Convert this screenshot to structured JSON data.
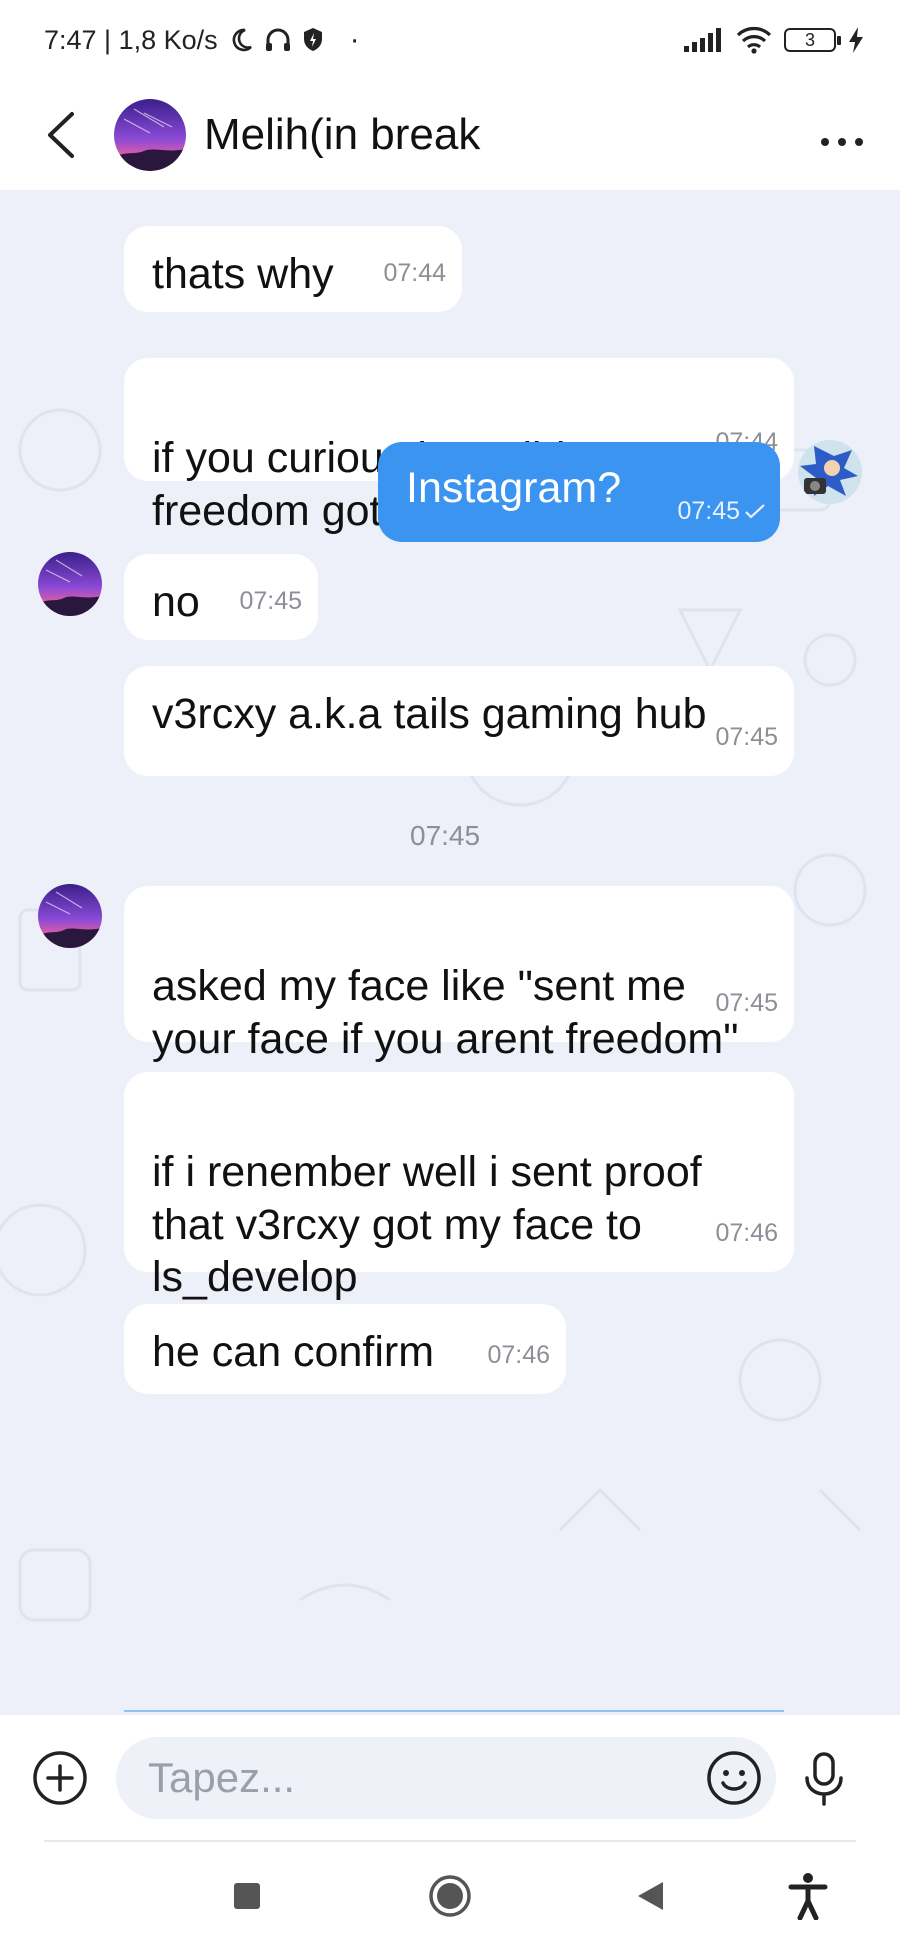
{
  "status_bar": {
    "time_speed": "7:47 | 1,8 Ko/s",
    "dot": "·",
    "battery": "3",
    "icons": [
      "moon-icon",
      "headphones-icon",
      "shield-icon",
      "signal-icon",
      "wifi-icon",
      "battery-icon",
      "charging-icon"
    ]
  },
  "header": {
    "title": "Melih(in break",
    "more": "···",
    "icons": [
      "back-arrow-icon",
      "contact-avatar",
      "more-icon"
    ]
  },
  "messages": [
    {
      "direction": "in",
      "text": "thats why",
      "time": "07:44",
      "avatar": false
    },
    {
      "direction": "in",
      "text": "if you curious how did\nfreedom got my face",
      "time": "07:44",
      "avatar": false
    },
    {
      "direction": "out",
      "text": "Instagram?",
      "time": "07:45",
      "status": "sent-check"
    },
    {
      "direction": "in",
      "text": "no",
      "time": "07:45",
      "avatar": true
    },
    {
      "direction": "in",
      "text": "v3rcxy a.k.a tails gaming hub",
      "time": "07:45",
      "avatar": false
    },
    {
      "direction": "in",
      "text": "asked my face like \"sent me\nyour face if you arent freedom\"",
      "time": "07:45",
      "avatar": true
    },
    {
      "direction": "in",
      "text": "if i renember well i sent proof\nthat v3rcxy got my face to\nls_develop",
      "time": "07:46",
      "avatar": false
    },
    {
      "direction": "in",
      "text": "he can confirm",
      "time": "07:46",
      "avatar": false
    }
  ],
  "date_separator": "07:45",
  "composer": {
    "placeholder": "Tapez...",
    "value": ""
  },
  "colors": {
    "accent": "#3b94ef",
    "chat_bg": "#edf0f8",
    "bubble_in": "#ffffff",
    "time_gray": "#8c8f96"
  }
}
